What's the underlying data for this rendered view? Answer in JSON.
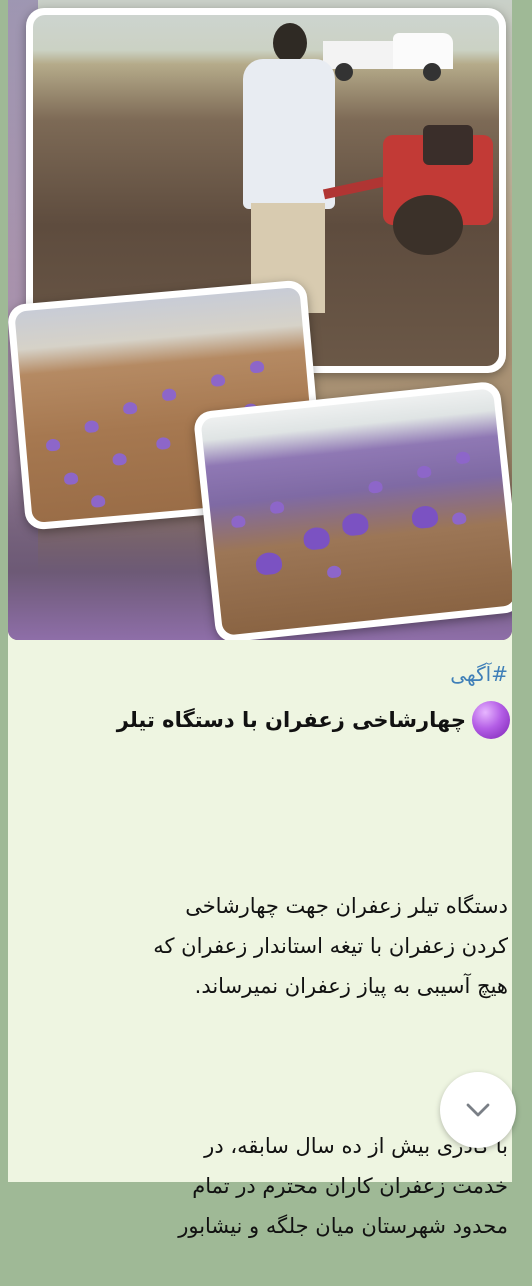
{
  "post": {
    "hashtag": "#آگهی",
    "title_icon": "purple-circle-icon",
    "title": "چهارشاخی زعفران با دستگاه تیلر",
    "body_paragraph_1": "دستگاه تیلر زعفران جهت چهارشاخی\nکردن زعفران با تیغه استاندار زعفران که\nهیچ آسیبی به پیاز زعفران نمیرساند.",
    "body_paragraph_2": "با کادری بیش از ده سال سابقه، در\nخدمت زعفران کاران محترم در تمام\nمحدود شهرستان میان جلگه و  نیشابور"
  },
  "controls": {
    "scroll_down_icon": "chevron-down-icon"
  },
  "colors": {
    "chat_background": "#9fb996",
    "bubble_background": "#eef5e1",
    "hashtag_link": "#3f7fb8",
    "text": "#111111"
  }
}
